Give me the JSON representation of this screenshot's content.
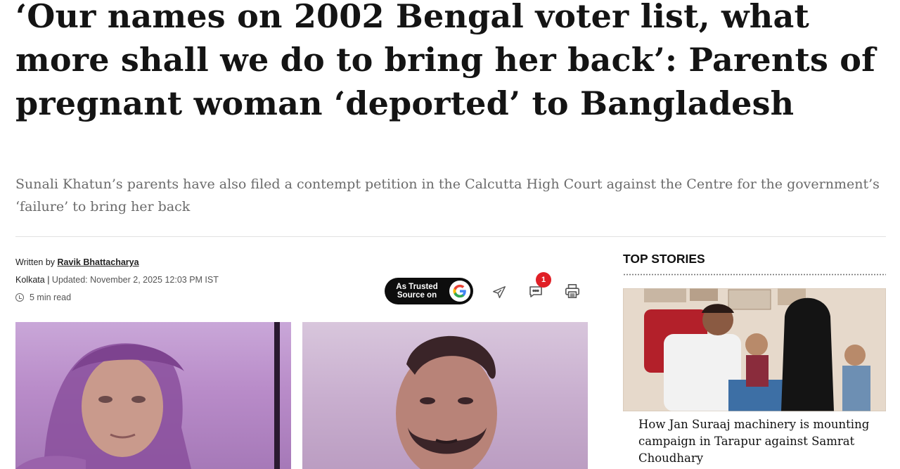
{
  "article": {
    "headline": "‘Our names on 2002 Bengal voter list, what more shall we do to bring her back’: Parents of pregnant woman ‘deported’ to Bangladesh",
    "subheadline": "Sunali Khatun’s parents have also filed a contempt petition in the Calcutta High Court against the Centre for the government’s ‘failure’ to bring her back",
    "byline": {
      "written_by_label": "Written by",
      "author": "Ravik Bhattacharya",
      "location": "Kolkata",
      "separator": "|",
      "updated": "Updated: November 2, 2025 12:03 PM IST",
      "read_time": "5 min read"
    },
    "trusted_source": {
      "line1": "As Trusted",
      "line2": "Source on",
      "icon": "google-g-icon"
    },
    "actions": {
      "share_icon": "send-icon",
      "comment_icon": "comment-icon",
      "comment_count": "1",
      "print_icon": "print-icon"
    }
  },
  "top_stories": {
    "title": "TOP STORIES",
    "items": [
      {
        "caption": "How Jan Suraaj machinery is mounting campaign in Tarapur against Samrat Choudhary"
      }
    ]
  },
  "colors": {
    "text": "#141414",
    "subtext": "#6b6b6b",
    "badge": "#e01f26",
    "trusted_bg": "#0d0d0d"
  }
}
